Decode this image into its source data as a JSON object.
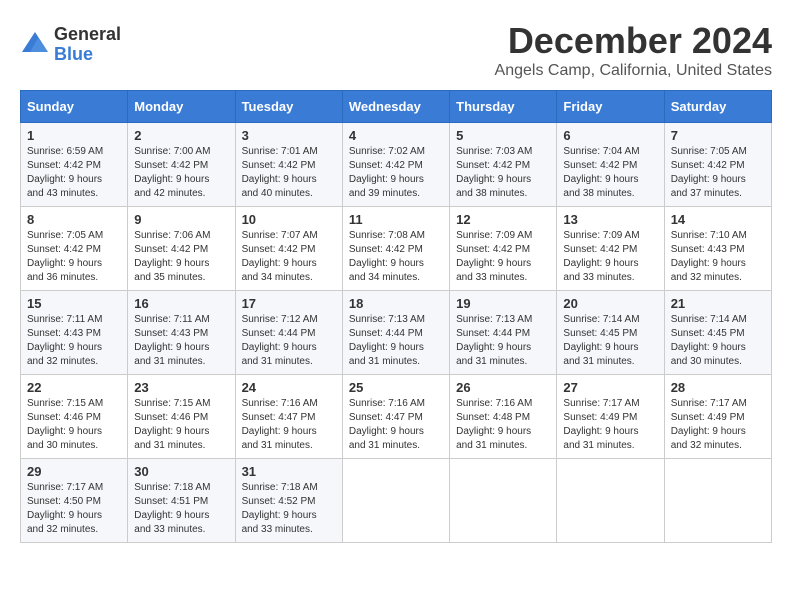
{
  "logo": {
    "general": "General",
    "blue": "Blue"
  },
  "title": "December 2024",
  "location": "Angels Camp, California, United States",
  "weekdays": [
    "Sunday",
    "Monday",
    "Tuesday",
    "Wednesday",
    "Thursday",
    "Friday",
    "Saturday"
  ],
  "weeks": [
    [
      {
        "day": "1",
        "sunrise": "6:59 AM",
        "sunset": "4:42 PM",
        "daylight": "9 hours and 43 minutes."
      },
      {
        "day": "2",
        "sunrise": "7:00 AM",
        "sunset": "4:42 PM",
        "daylight": "9 hours and 42 minutes."
      },
      {
        "day": "3",
        "sunrise": "7:01 AM",
        "sunset": "4:42 PM",
        "daylight": "9 hours and 40 minutes."
      },
      {
        "day": "4",
        "sunrise": "7:02 AM",
        "sunset": "4:42 PM",
        "daylight": "9 hours and 39 minutes."
      },
      {
        "day": "5",
        "sunrise": "7:03 AM",
        "sunset": "4:42 PM",
        "daylight": "9 hours and 38 minutes."
      },
      {
        "day": "6",
        "sunrise": "7:04 AM",
        "sunset": "4:42 PM",
        "daylight": "9 hours and 38 minutes."
      },
      {
        "day": "7",
        "sunrise": "7:05 AM",
        "sunset": "4:42 PM",
        "daylight": "9 hours and 37 minutes."
      }
    ],
    [
      {
        "day": "8",
        "sunrise": "7:05 AM",
        "sunset": "4:42 PM",
        "daylight": "9 hours and 36 minutes."
      },
      {
        "day": "9",
        "sunrise": "7:06 AM",
        "sunset": "4:42 PM",
        "daylight": "9 hours and 35 minutes."
      },
      {
        "day": "10",
        "sunrise": "7:07 AM",
        "sunset": "4:42 PM",
        "daylight": "9 hours and 34 minutes."
      },
      {
        "day": "11",
        "sunrise": "7:08 AM",
        "sunset": "4:42 PM",
        "daylight": "9 hours and 34 minutes."
      },
      {
        "day": "12",
        "sunrise": "7:09 AM",
        "sunset": "4:42 PM",
        "daylight": "9 hours and 33 minutes."
      },
      {
        "day": "13",
        "sunrise": "7:09 AM",
        "sunset": "4:42 PM",
        "daylight": "9 hours and 33 minutes."
      },
      {
        "day": "14",
        "sunrise": "7:10 AM",
        "sunset": "4:43 PM",
        "daylight": "9 hours and 32 minutes."
      }
    ],
    [
      {
        "day": "15",
        "sunrise": "7:11 AM",
        "sunset": "4:43 PM",
        "daylight": "9 hours and 32 minutes."
      },
      {
        "day": "16",
        "sunrise": "7:11 AM",
        "sunset": "4:43 PM",
        "daylight": "9 hours and 31 minutes."
      },
      {
        "day": "17",
        "sunrise": "7:12 AM",
        "sunset": "4:44 PM",
        "daylight": "9 hours and 31 minutes."
      },
      {
        "day": "18",
        "sunrise": "7:13 AM",
        "sunset": "4:44 PM",
        "daylight": "9 hours and 31 minutes."
      },
      {
        "day": "19",
        "sunrise": "7:13 AM",
        "sunset": "4:44 PM",
        "daylight": "9 hours and 31 minutes."
      },
      {
        "day": "20",
        "sunrise": "7:14 AM",
        "sunset": "4:45 PM",
        "daylight": "9 hours and 31 minutes."
      },
      {
        "day": "21",
        "sunrise": "7:14 AM",
        "sunset": "4:45 PM",
        "daylight": "9 hours and 30 minutes."
      }
    ],
    [
      {
        "day": "22",
        "sunrise": "7:15 AM",
        "sunset": "4:46 PM",
        "daylight": "9 hours and 30 minutes."
      },
      {
        "day": "23",
        "sunrise": "7:15 AM",
        "sunset": "4:46 PM",
        "daylight": "9 hours and 31 minutes."
      },
      {
        "day": "24",
        "sunrise": "7:16 AM",
        "sunset": "4:47 PM",
        "daylight": "9 hours and 31 minutes."
      },
      {
        "day": "25",
        "sunrise": "7:16 AM",
        "sunset": "4:47 PM",
        "daylight": "9 hours and 31 minutes."
      },
      {
        "day": "26",
        "sunrise": "7:16 AM",
        "sunset": "4:48 PM",
        "daylight": "9 hours and 31 minutes."
      },
      {
        "day": "27",
        "sunrise": "7:17 AM",
        "sunset": "4:49 PM",
        "daylight": "9 hours and 31 minutes."
      },
      {
        "day": "28",
        "sunrise": "7:17 AM",
        "sunset": "4:49 PM",
        "daylight": "9 hours and 32 minutes."
      }
    ],
    [
      {
        "day": "29",
        "sunrise": "7:17 AM",
        "sunset": "4:50 PM",
        "daylight": "9 hours and 32 minutes."
      },
      {
        "day": "30",
        "sunrise": "7:18 AM",
        "sunset": "4:51 PM",
        "daylight": "9 hours and 33 minutes."
      },
      {
        "day": "31",
        "sunrise": "7:18 AM",
        "sunset": "4:52 PM",
        "daylight": "9 hours and 33 minutes."
      },
      null,
      null,
      null,
      null
    ]
  ]
}
